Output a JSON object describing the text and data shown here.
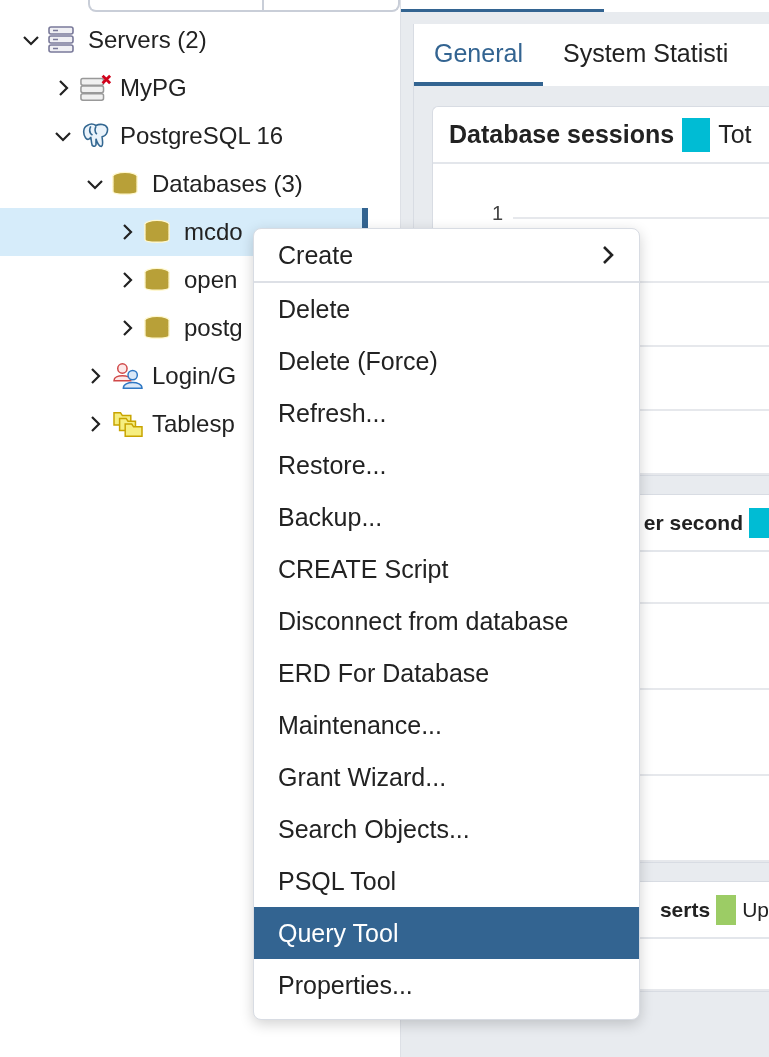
{
  "tree": [
    {
      "label": "Servers (2)",
      "kind": "server-group",
      "expanded": true,
      "selected": false,
      "children": [
        {
          "label": "MyPG",
          "kind": "server-disconnected",
          "expanded": false,
          "selected": false
        },
        {
          "label": "PostgreSQL 16",
          "kind": "server",
          "expanded": true,
          "selected": false,
          "children": [
            {
              "label": "Databases (3)",
              "kind": "databases",
              "expanded": true,
              "selected": false,
              "children": [
                {
                  "label": "mcdo",
                  "kind": "database",
                  "expanded": false,
                  "selected": true
                },
                {
                  "label": "open",
                  "kind": "database",
                  "expanded": false,
                  "selected": false
                },
                {
                  "label": "postg",
                  "kind": "database",
                  "expanded": false,
                  "selected": false
                }
              ]
            },
            {
              "label": "Login/G",
              "kind": "login-roles",
              "expanded": false,
              "selected": false
            },
            {
              "label": "Tablesp",
              "kind": "tablespaces",
              "expanded": false,
              "selected": false
            }
          ]
        }
      ]
    }
  ],
  "dashboard_tabs": [
    {
      "label": "General",
      "selected": true
    },
    {
      "label": "System Statisti",
      "selected": false
    }
  ],
  "cards": [
    {
      "title": "Database sessions",
      "legend": [
        {
          "label": "Tot",
          "color": "#00bcd4"
        }
      ],
      "y_tick": "1"
    },
    {
      "title": "er second",
      "legend": [
        {
          "color": "#00bcd4"
        }
      ]
    },
    {
      "title": "serts",
      "legend": [
        {
          "label": "Up",
          "color": "#9ccc65"
        }
      ]
    }
  ],
  "context_menu": [
    {
      "label": "Create",
      "kind": "submenu",
      "selected": false
    },
    {
      "label": "Delete",
      "kind": "item",
      "selected": false
    },
    {
      "label": "Delete (Force)",
      "kind": "item",
      "selected": false
    },
    {
      "label": "Refresh...",
      "kind": "item",
      "selected": false
    },
    {
      "label": "Restore...",
      "kind": "item",
      "selected": false
    },
    {
      "label": "Backup...",
      "kind": "item",
      "selected": false
    },
    {
      "label": "CREATE Script",
      "kind": "item",
      "selected": false
    },
    {
      "label": "Disconnect from database",
      "kind": "item",
      "selected": false
    },
    {
      "label": "ERD For Database",
      "kind": "item",
      "selected": false
    },
    {
      "label": "Maintenance...",
      "kind": "item",
      "selected": false
    },
    {
      "label": "Grant Wizard...",
      "kind": "item",
      "selected": false
    },
    {
      "label": "Search Objects...",
      "kind": "item",
      "selected": false
    },
    {
      "label": "PSQL Tool",
      "kind": "item",
      "selected": false
    },
    {
      "label": "Query Tool",
      "kind": "item",
      "selected": true
    },
    {
      "label": "Properties...",
      "kind": "item",
      "selected": false
    }
  ]
}
